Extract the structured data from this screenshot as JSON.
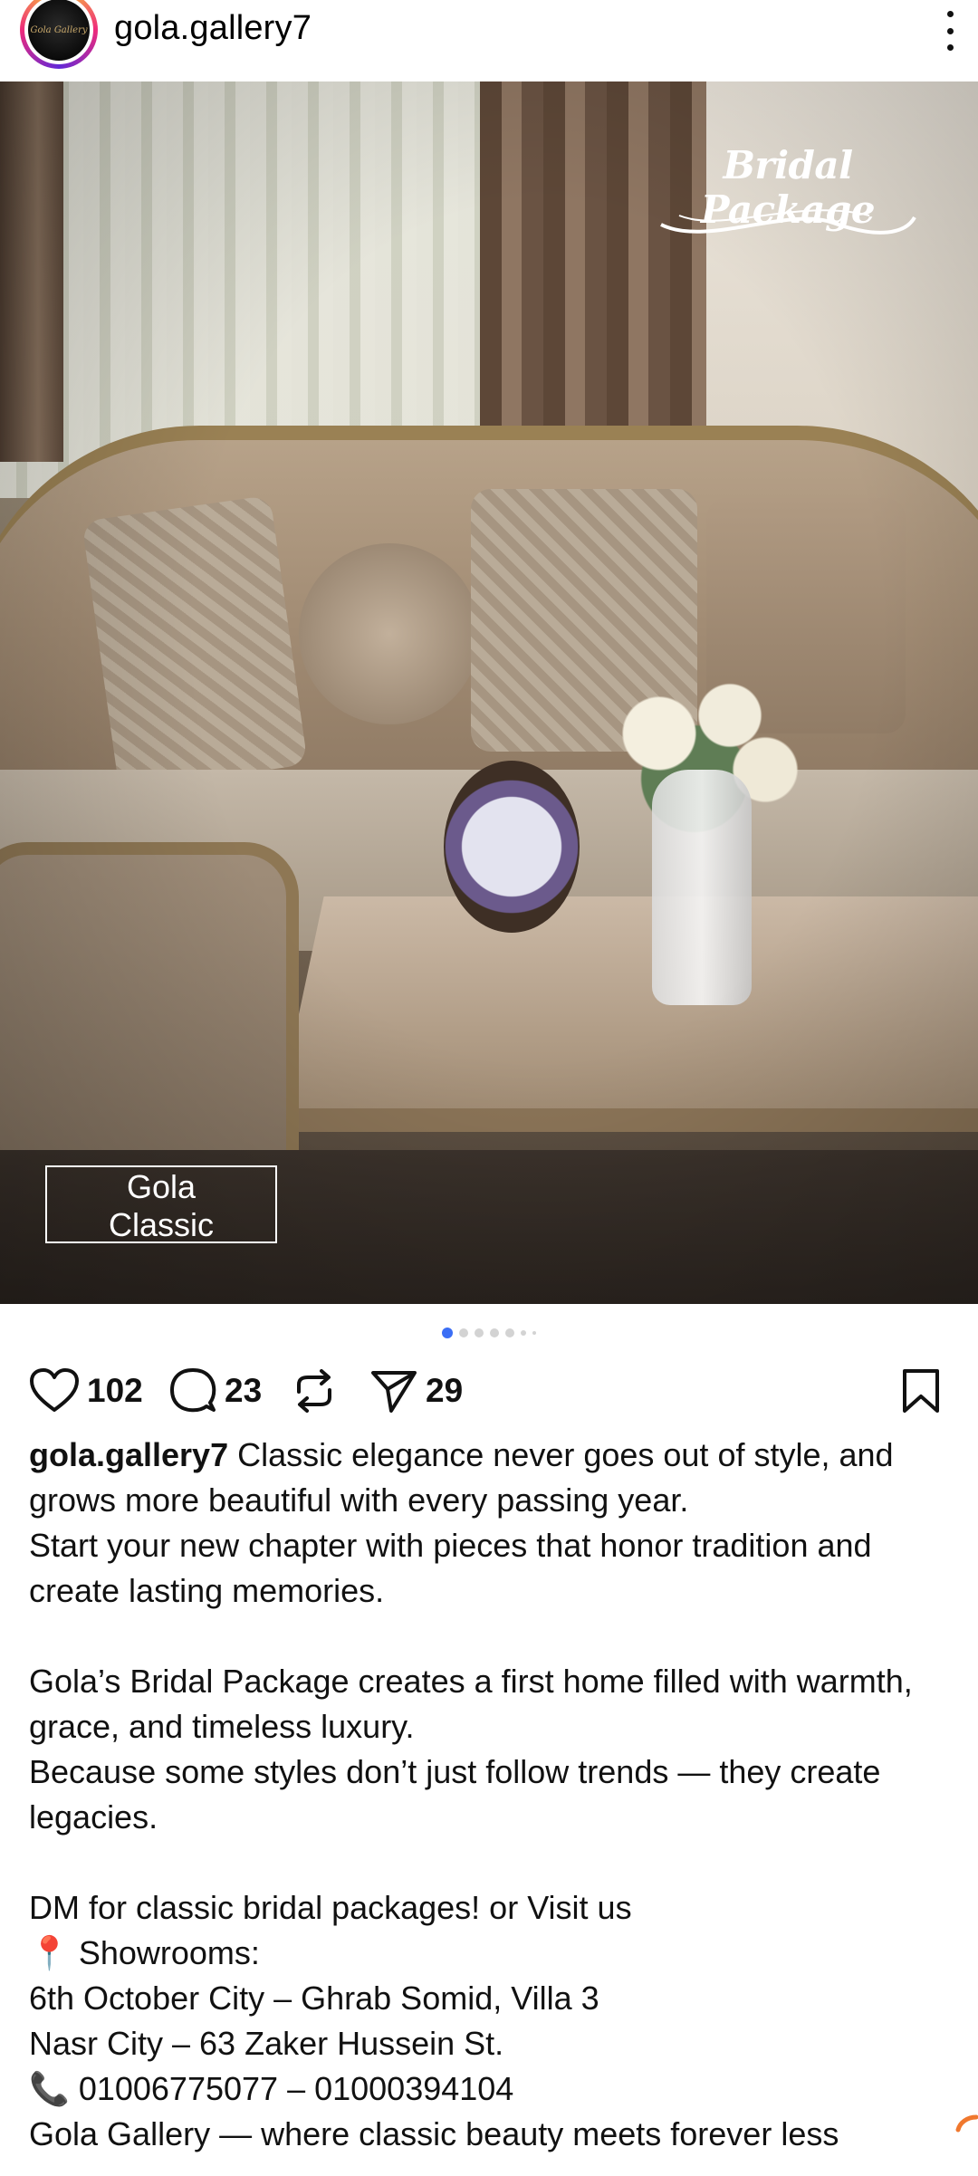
{
  "header": {
    "username": "gola.gallery7",
    "avatar_text": "Gola Gallery"
  },
  "post_media": {
    "overlay_logo": "Bridal Package",
    "overlay_box_line1": "Gola",
    "overlay_box_line2": "Classic",
    "carousel": {
      "total_dots": 7,
      "active_index": 0
    }
  },
  "actions": {
    "likes": "102",
    "comments": "23",
    "shares": "29"
  },
  "caption": {
    "username": "gola.gallery7",
    "para1": "Classic elegance never goes out of style, and grows more beautiful with every passing year.",
    "para2": "Start your new chapter with pieces that honor tradition and create lasting memories.",
    "para3": "Gola’s Bridal Package creates a first home filled with warmth, grace, and timeless luxury.",
    "para4": "Because some styles don’t just follow trends — they create legacies.",
    "para5": "DM for classic bridal packages! or Visit us",
    "showrooms": "📍 Showrooms:",
    "branch1": "6th October City – Ghrab Somid, Villa 3",
    "branch2": "Nasr City – 63 Zaker Hussein St.",
    "phones": "📞 01006775077 – 01000394104",
    "tagline": "Gola Gallery — where classic beauty meets forever less"
  },
  "colors": {
    "accent_blue": "#3b6ef5",
    "text": "#111111",
    "background": "#ffffff"
  }
}
